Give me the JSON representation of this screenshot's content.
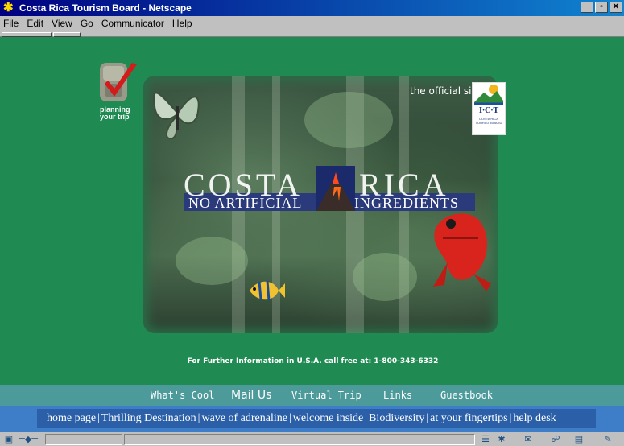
{
  "window": {
    "title": "Costa Rica Tourism Board - Netscape"
  },
  "menu": [
    "File",
    "Edit",
    "View",
    "Go",
    "Communicator",
    "Help"
  ],
  "planning": {
    "label_line1": "planning",
    "label_line2": "your trip"
  },
  "hero": {
    "official": "the official site",
    "logo_text": "I·C·T",
    "logo_sub": "COSTA RICA TOURIST BOARD",
    "title_left": "COSTA",
    "title_right": "RICA",
    "tagline_left": "NO ARTIFICIAL",
    "tagline_right": "INGREDIENTS"
  },
  "info": {
    "phone_line": "For Further Information in U.S.A. call free at: 1-800-343-6332"
  },
  "nav_top": [
    "What's Cool",
    "Mail Us",
    "Virtual Trip",
    "Links",
    "Guestbook"
  ],
  "nav_bottom": [
    "home page",
    "Thrilling Destination",
    "wave of adrenaline",
    "welcome inside",
    "Biodiversity",
    "at your fingertips",
    "help desk"
  ],
  "colors": {
    "page_bg": "#1f8b52",
    "nav_top_bg": "#4d9a9a",
    "nav_bottom_bg": "#2b5fa7",
    "title_bar": "#000080"
  }
}
